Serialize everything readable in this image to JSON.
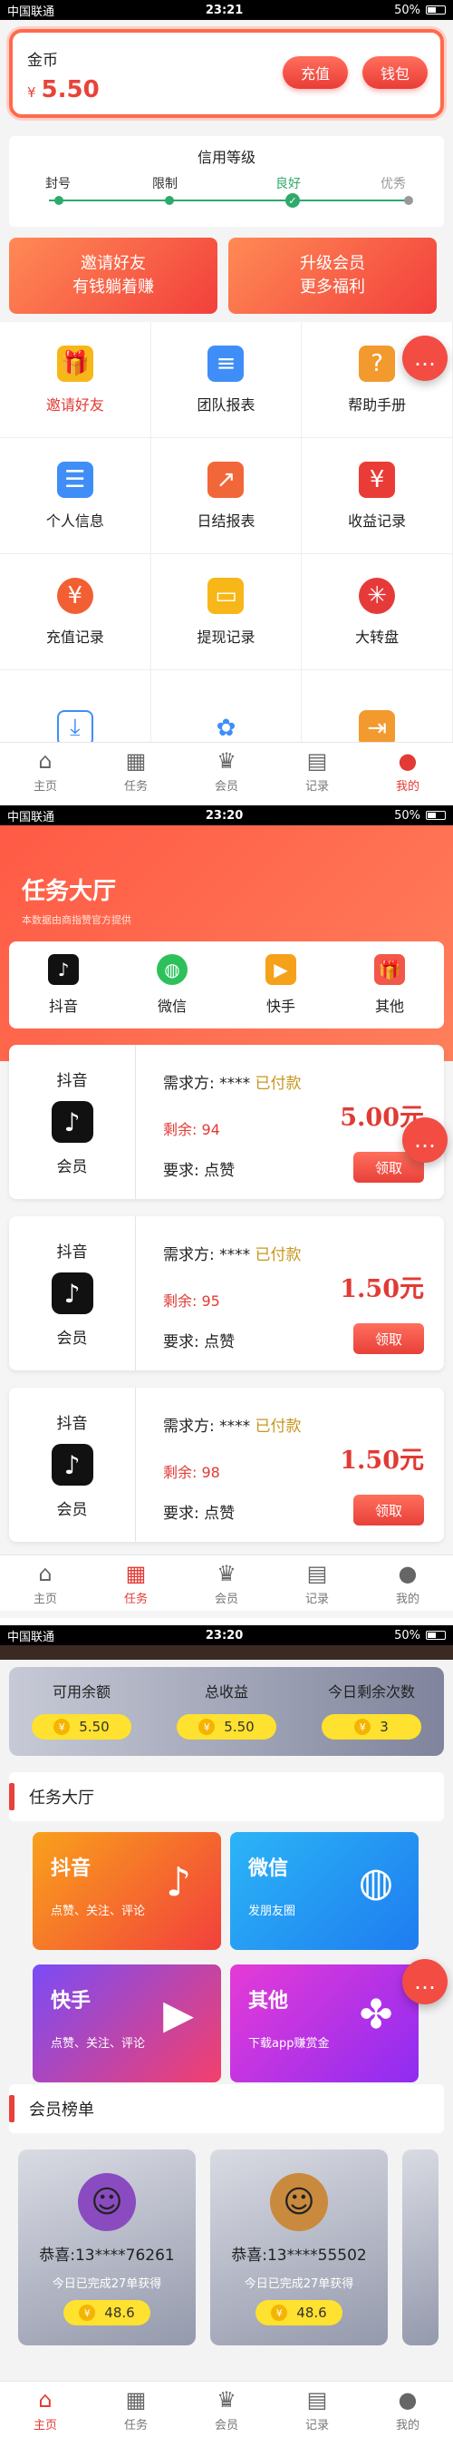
{
  "status_bars": [
    {
      "carrier": "中国联通",
      "time": "23:21",
      "battery": "50%"
    },
    {
      "carrier": "中国联通",
      "time": "23:20",
      "battery": "50%"
    },
    {
      "carrier": "中国联通",
      "time": "23:20",
      "battery": "50%"
    }
  ],
  "mine": {
    "coin_label": "金币",
    "coin_symbol": "¥",
    "coin_value": "5.50",
    "recharge": "充值",
    "wallet": "钱包",
    "credit": {
      "title": "信用等级",
      "levels": [
        "封号",
        "限制",
        "良好",
        "优秀"
      ]
    },
    "invite_btn": [
      "邀请好友",
      "有钱躺着赚"
    ],
    "vip_btn": [
      "升级会员",
      "更多福利"
    ],
    "menu": [
      {
        "label": "邀请好友",
        "icon": "gift-icon",
        "color": "#f7b719"
      },
      {
        "label": "团队报表",
        "icon": "layers-icon",
        "color": "#3f8ef7"
      },
      {
        "label": "帮助手册",
        "icon": "help-icon",
        "color": "#f29a2e"
      },
      {
        "label": "个人信息",
        "icon": "id-card-icon",
        "color": "#3f8ef7"
      },
      {
        "label": "日结报表",
        "icon": "chart-up-icon",
        "color": "#f2673a"
      },
      {
        "label": "收益记录",
        "icon": "income-icon",
        "color": "#ea3c36"
      },
      {
        "label": "充值记录",
        "icon": "money-bag-icon",
        "color": "#f25f33"
      },
      {
        "label": "提现记录",
        "icon": "wallet-icon",
        "color": "#f7b719"
      },
      {
        "label": "大转盘",
        "icon": "wheel-icon",
        "color": "#e63a3a"
      },
      {
        "label": "",
        "icon": "download-icon",
        "color": "#3f8ef7"
      },
      {
        "label": "",
        "icon": "flower-icon",
        "color": "#3f8ef7"
      },
      {
        "label": "",
        "icon": "logout-icon",
        "color": "#f29a2e"
      }
    ]
  },
  "tabs": [
    "主页",
    "任务",
    "会员",
    "记录",
    "我的"
  ],
  "hall": {
    "title": "任务大厅",
    "subtitle": "本数据由商指赞官方提供",
    "categories": [
      {
        "label": "抖音",
        "icon": "tiktok-icon"
      },
      {
        "label": "微信",
        "icon": "wechat-icon"
      },
      {
        "label": "快手",
        "icon": "kuaishou-icon"
      },
      {
        "label": "其他",
        "icon": "gift-icon"
      }
    ],
    "tasks": [
      {
        "platform": "抖音",
        "tier": "会员",
        "demand": "需求方: ****",
        "paid": "已付款",
        "remaining": "剩余: 94",
        "require": "要求: 点赞",
        "price": "5.00元",
        "action": "领取"
      },
      {
        "platform": "抖音",
        "tier": "会员",
        "demand": "需求方: ****",
        "paid": "已付款",
        "remaining": "剩余: 95",
        "require": "要求: 点赞",
        "price": "1.50元",
        "action": "领取"
      },
      {
        "platform": "抖音",
        "tier": "会员",
        "demand": "需求方: ****",
        "paid": "已付款",
        "remaining": "剩余: 98",
        "require": "要求: 点赞",
        "price": "1.50元",
        "action": "领取"
      }
    ]
  },
  "home": {
    "stats": [
      {
        "label": "可用余额",
        "value": "5.50"
      },
      {
        "label": "总收益",
        "value": "5.50"
      },
      {
        "label": "今日剩余次数",
        "value": "3"
      }
    ],
    "coin_symbol": "¥",
    "hall_section": "任务大厅",
    "task_cards": [
      {
        "name": "抖音",
        "desc": "点赞、关注、评论",
        "color1": "#f9a11b",
        "color2": "#f2403c",
        "icon": "tiktok-icon"
      },
      {
        "name": "微信",
        "desc": "发朋友圈",
        "color1": "#2bb5f6",
        "color2": "#1f7cf0",
        "icon": "wechat-icon"
      },
      {
        "name": "快手",
        "desc": "点赞、关注、评论",
        "color1": "#7a4cf6",
        "color2": "#f43f6c",
        "icon": "kuaishou-icon"
      },
      {
        "name": "其他",
        "desc": "下载app赚赏金",
        "color1": "#e53bd6",
        "color2": "#8f2cf2",
        "icon": "clover-icon"
      }
    ],
    "member_section": "会员榜单",
    "members": [
      {
        "name": "恭喜:13****76261",
        "done": "今日已完成27单获得",
        "value": "48.6"
      },
      {
        "name": "恭喜:13****55502",
        "done": "今日已完成27单获得",
        "value": "48.6"
      }
    ]
  }
}
